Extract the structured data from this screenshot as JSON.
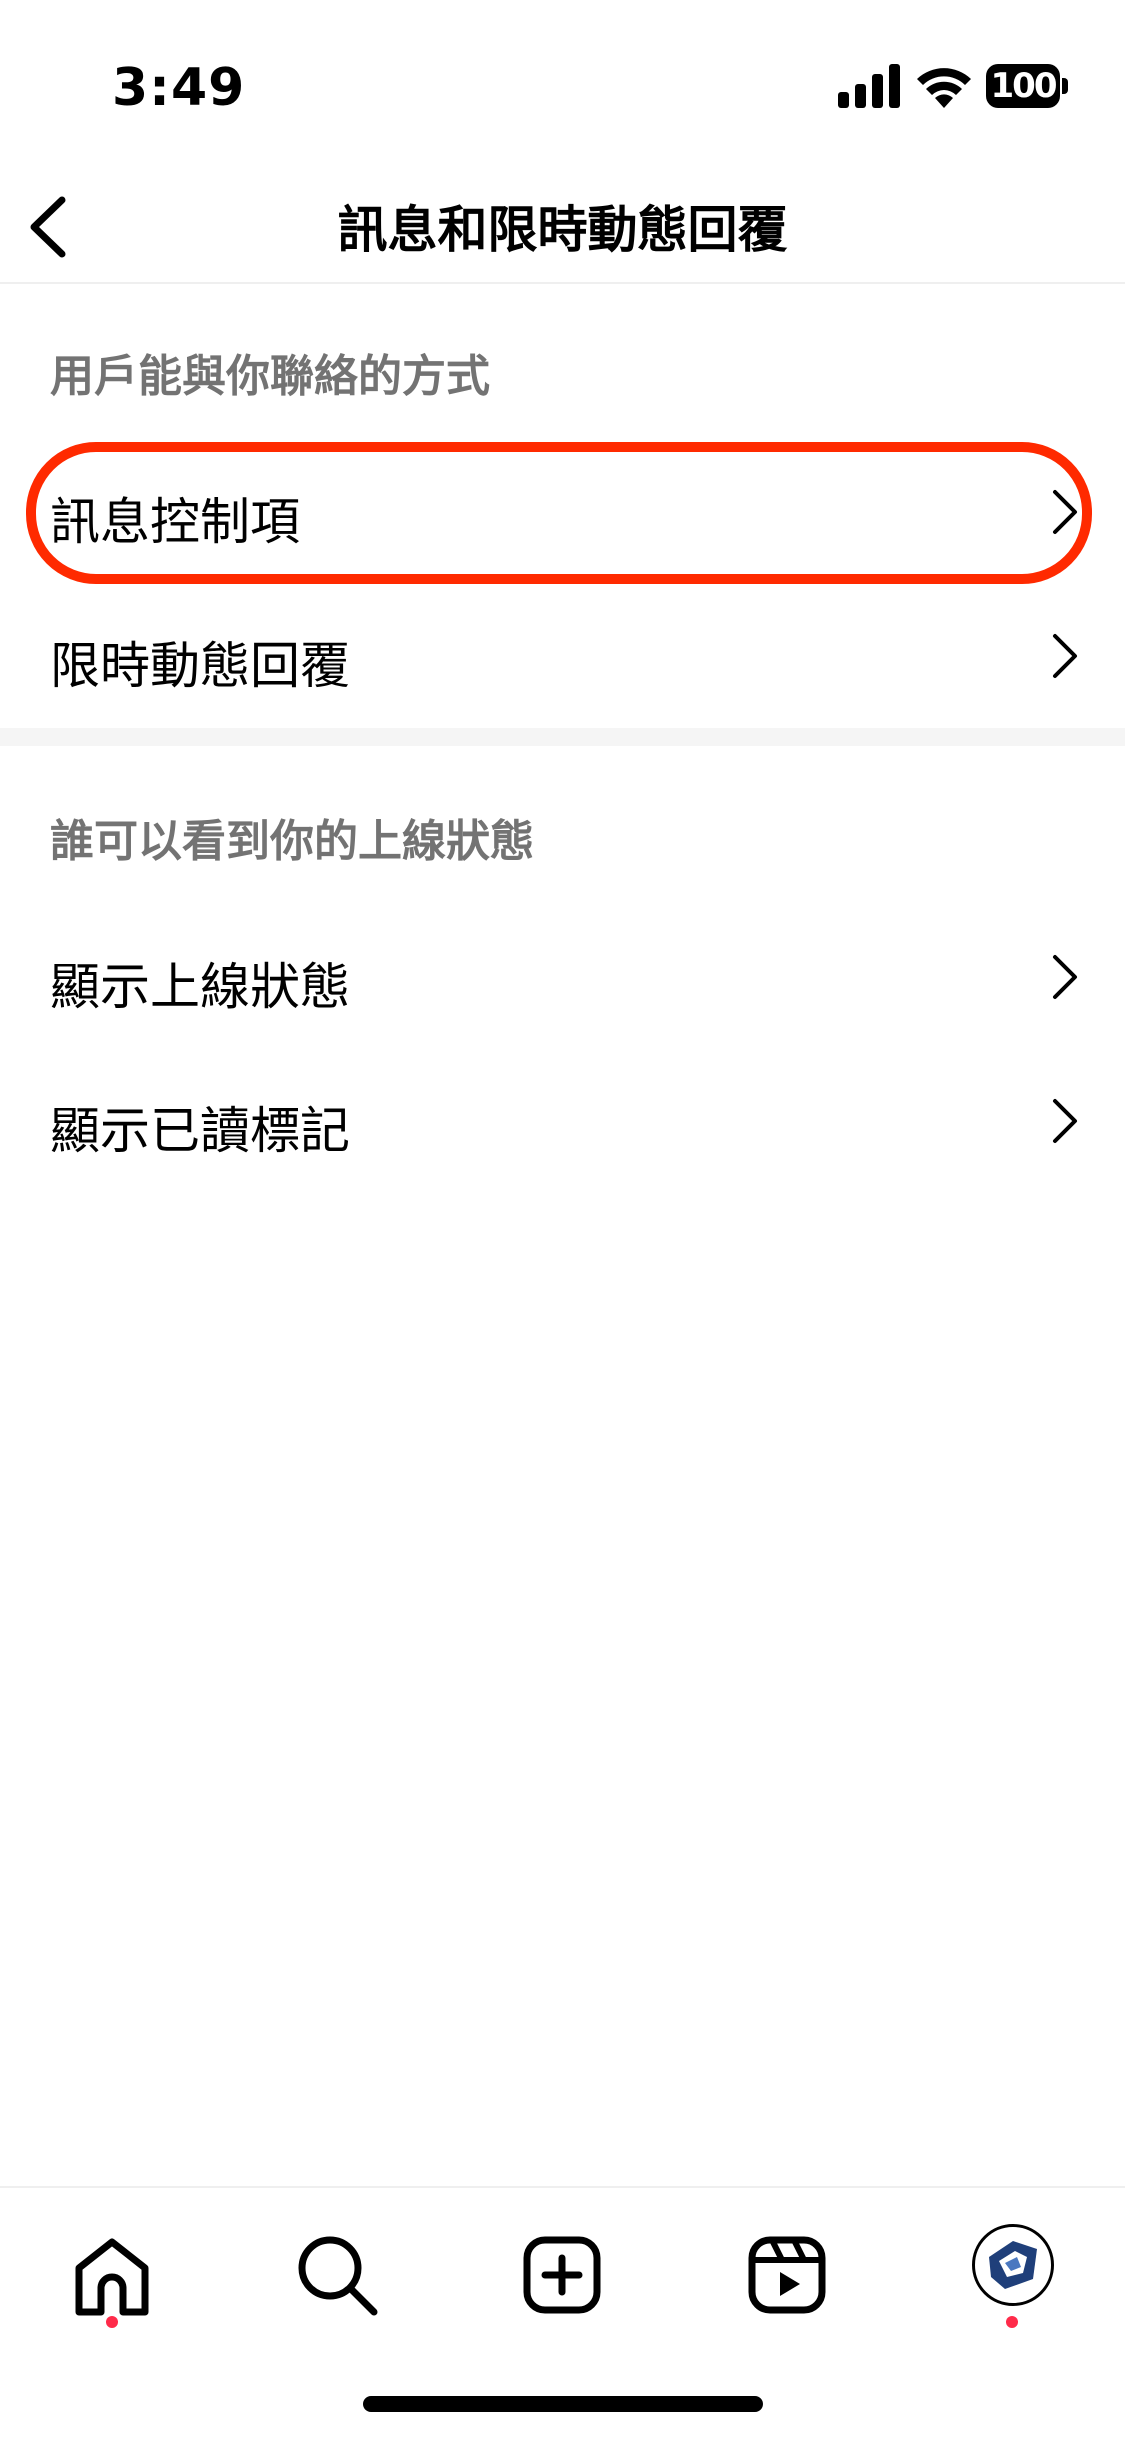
{
  "status_bar": {
    "time": "3:49",
    "battery": "100"
  },
  "nav": {
    "title": "訊息和限時動態回覆",
    "back_icon": "chevron-left-icon"
  },
  "sections": [
    {
      "header": "用戶能與你聯絡的方式",
      "items": [
        {
          "label": "訊息控制項",
          "highlighted": true
        },
        {
          "label": "限時動態回覆"
        }
      ]
    },
    {
      "header": "誰可以看到你的上線狀態",
      "items": [
        {
          "label": "顯示上線狀態"
        },
        {
          "label": "顯示已讀標記"
        }
      ]
    }
  ],
  "tab_bar": {
    "tabs": [
      {
        "icon": "home-icon",
        "notification_dot": true
      },
      {
        "icon": "search-icon"
      },
      {
        "icon": "create-post-icon"
      },
      {
        "icon": "reels-icon"
      },
      {
        "icon": "profile-avatar",
        "notification_dot": true
      }
    ]
  },
  "colors": {
    "highlight_ring": "#ff2a00",
    "section_header": "#737373",
    "notification_dot": "#ff2b4a"
  }
}
